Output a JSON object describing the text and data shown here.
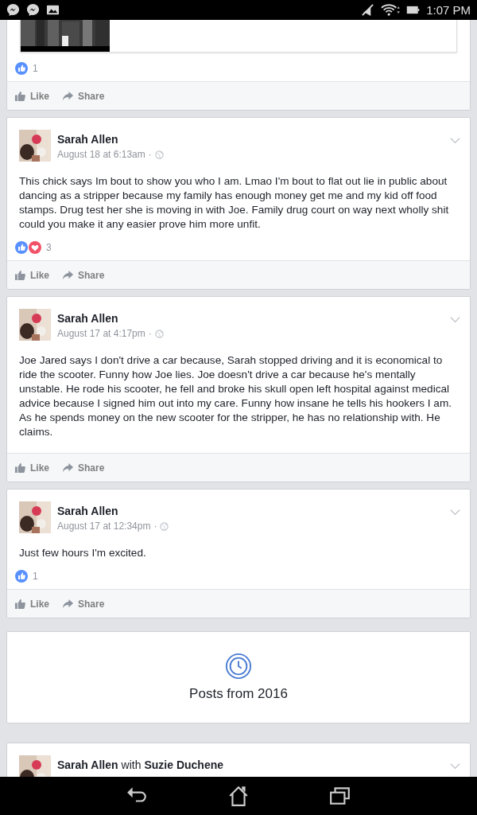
{
  "status_bar": {
    "time": "1:07 PM"
  },
  "posts": [
    {
      "kind": "tail",
      "reactions": [
        {
          "kind": "like"
        }
      ],
      "reaction_count": "1",
      "actions": [
        "Like",
        "Share"
      ]
    },
    {
      "kind": "post",
      "author": "Sarah Allen",
      "time": "August 18 at 6:13am",
      "separator": "·",
      "text": "This chick says Im bout to show you who I am. Lmao I'm bout to flat out lie in public about dancing as a stripper because my family has enough money get me and my kid off food stamps. Drug test her she is moving in with Joe. Family drug court on way next wholly shit could you make it any easier prove him more unfit.",
      "reactions": [
        {
          "kind": "like"
        },
        {
          "kind": "love"
        }
      ],
      "reaction_count": "3",
      "actions": [
        "Like",
        "Share"
      ]
    },
    {
      "kind": "post",
      "author": "Sarah Allen",
      "time": "August 17 at 4:17pm",
      "separator": "·",
      "text": "Joe Jared says I don't drive a car because, Sarah stopped driving and it is economical to ride the scooter. Funny how Joe lies. Joe doesn't drive a car because he's mentally unstable. He rode his scooter, he fell and broke his skull open left hospital against medical advice because I signed him out into my care. Funny how insane he tells his hookers I am. As he spends money on the new scooter for the stripper, he has no relationship with. He claims.",
      "actions": [
        "Like",
        "Share"
      ]
    },
    {
      "kind": "post",
      "author": "Sarah Allen",
      "time": "August 17 at 12:34pm",
      "separator": "·",
      "text": "Just few hours I'm excited.",
      "reactions": [
        {
          "kind": "like"
        }
      ],
      "reaction_count": "1",
      "actions": [
        "Like",
        "Share"
      ]
    },
    {
      "kind": "year",
      "label": "Posts from 2016"
    },
    {
      "kind": "post",
      "author": "Sarah Allen",
      "with": "with",
      "tagged": "Suzie Duchene"
    }
  ]
}
